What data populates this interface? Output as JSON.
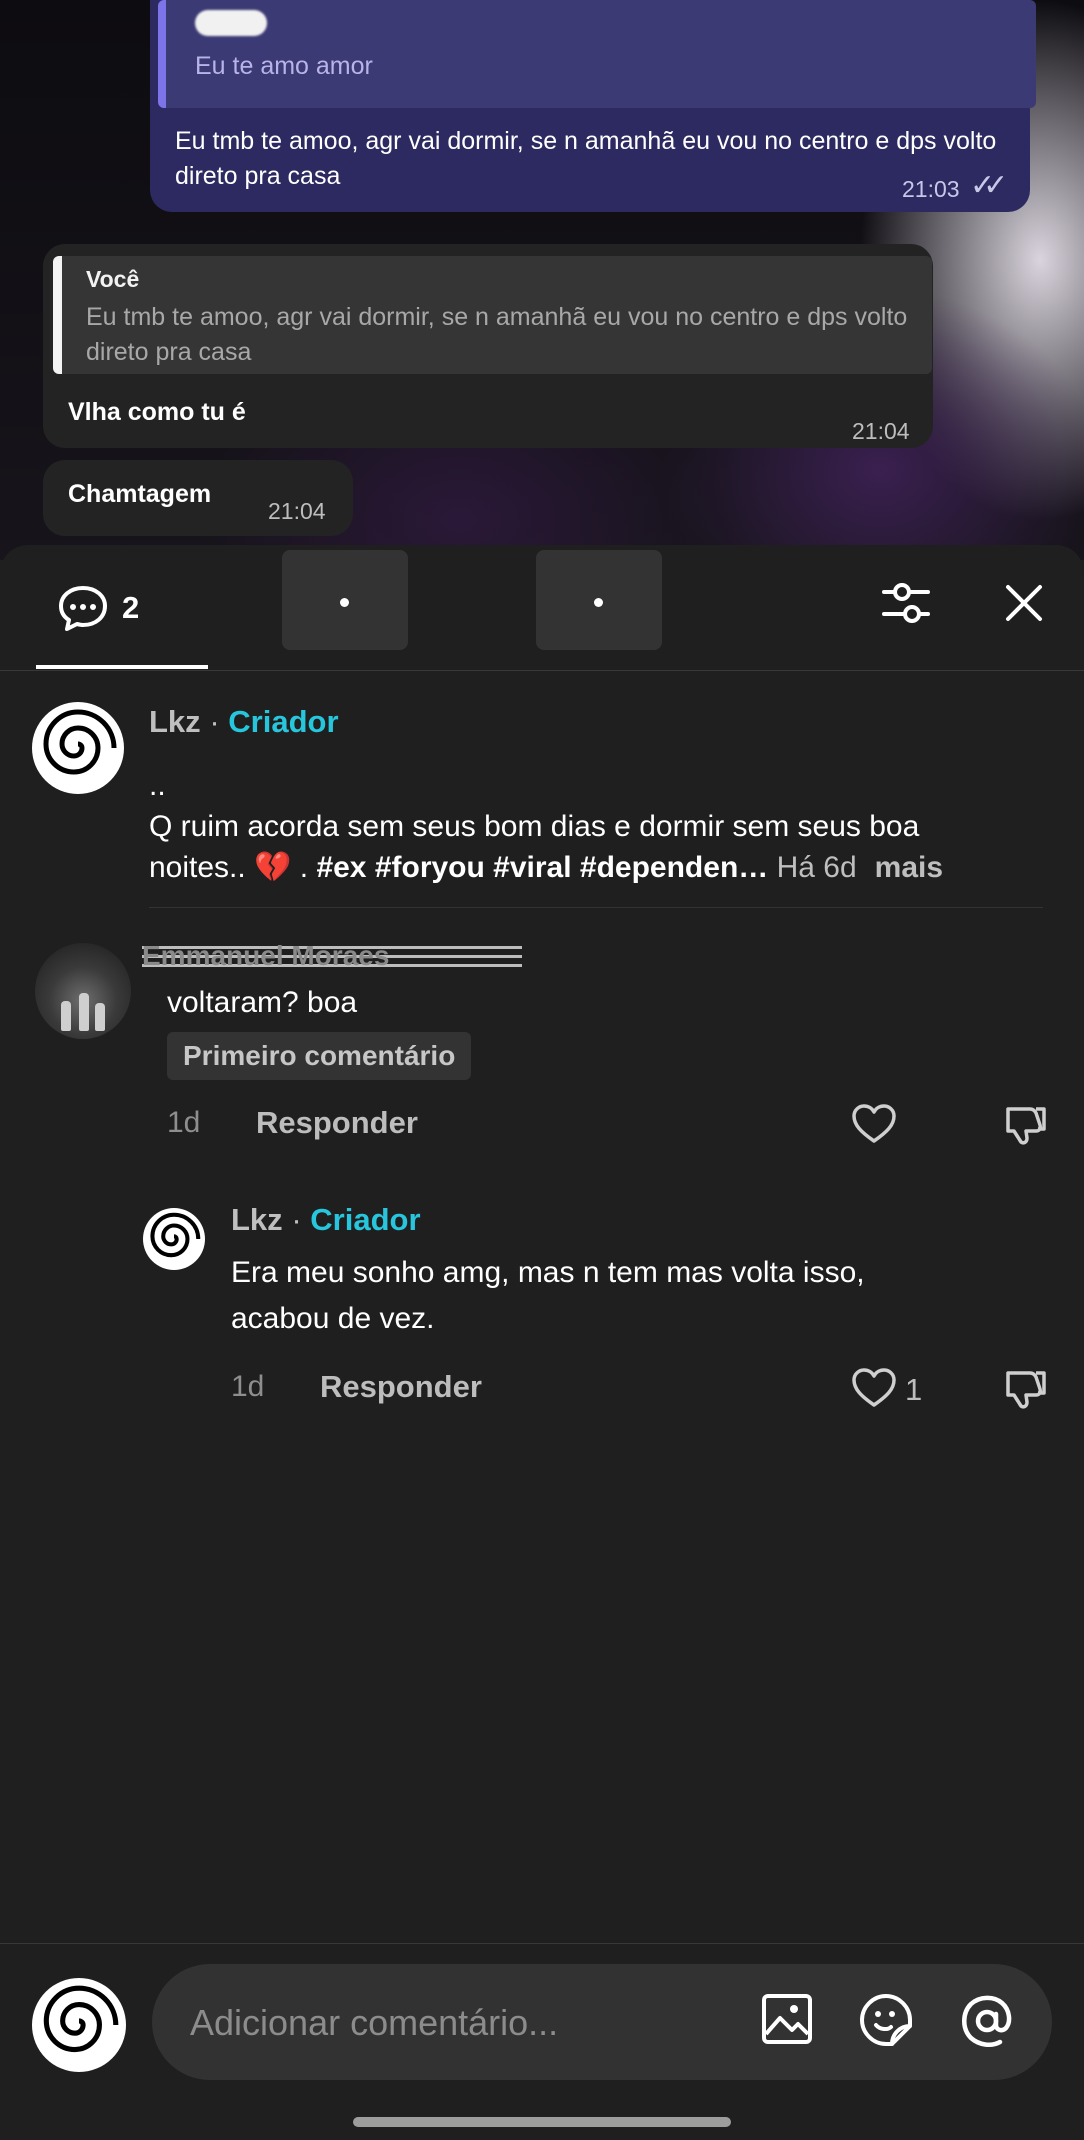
{
  "chat": {
    "outgoing": {
      "quoted_text": "Eu te amo amor",
      "message": "Eu tmb te amoo, agr vai dormir, se n amanhã eu vou no centro e dps volto direto pra casa",
      "time": "21:03"
    },
    "incoming_1": {
      "quoted_name": "Você",
      "quoted_text": "Eu tmb te amoo, agr vai dormir, se n amanhã eu vou no centro e dps volto direto pra casa",
      "message": "Vlha como tu é",
      "time": "21:04"
    },
    "incoming_2": {
      "message": "Chamtagem",
      "time": "21:04"
    }
  },
  "sheet": {
    "comment_count": "2",
    "caption": {
      "author": "Lkz",
      "separator": "·",
      "creator_label": "Criador",
      "line1": "..",
      "line2": "Q ruim acorda sem seus bom dias e dormir sem seus boa",
      "line3_start": "noites.. ",
      "emoji": "💔",
      "line3_mid": " . ",
      "hashtags": "#ex #foryou #viral #dependen…",
      "age": " Há 6d",
      "more": "mais"
    },
    "comments": [
      {
        "author_redacted": "Emmanuel Moraes",
        "text": "voltaram? boa",
        "badge": "Primeiro comentário",
        "age": "1d",
        "reply_label": "Responder"
      }
    ],
    "reply": {
      "author": "Lkz",
      "separator": "·",
      "creator_label": "Criador",
      "text_line1": "Era meu sonho amg, mas n tem mas volta isso,",
      "text_line2": "acabou de vez.",
      "age": "1d",
      "reply_label": "Responder",
      "likes": "1"
    }
  },
  "input": {
    "placeholder": "Adicionar comentário..."
  },
  "colors": {
    "creator": "#27c6dd",
    "sheet_bg": "#1f1f1f",
    "outgoing_bubble": "#2c2a60"
  },
  "icons": [
    "comment-icon",
    "filter-icon",
    "close-icon",
    "heart-icon",
    "dislike-icon",
    "image-icon",
    "sticker-icon",
    "mention-icon"
  ]
}
